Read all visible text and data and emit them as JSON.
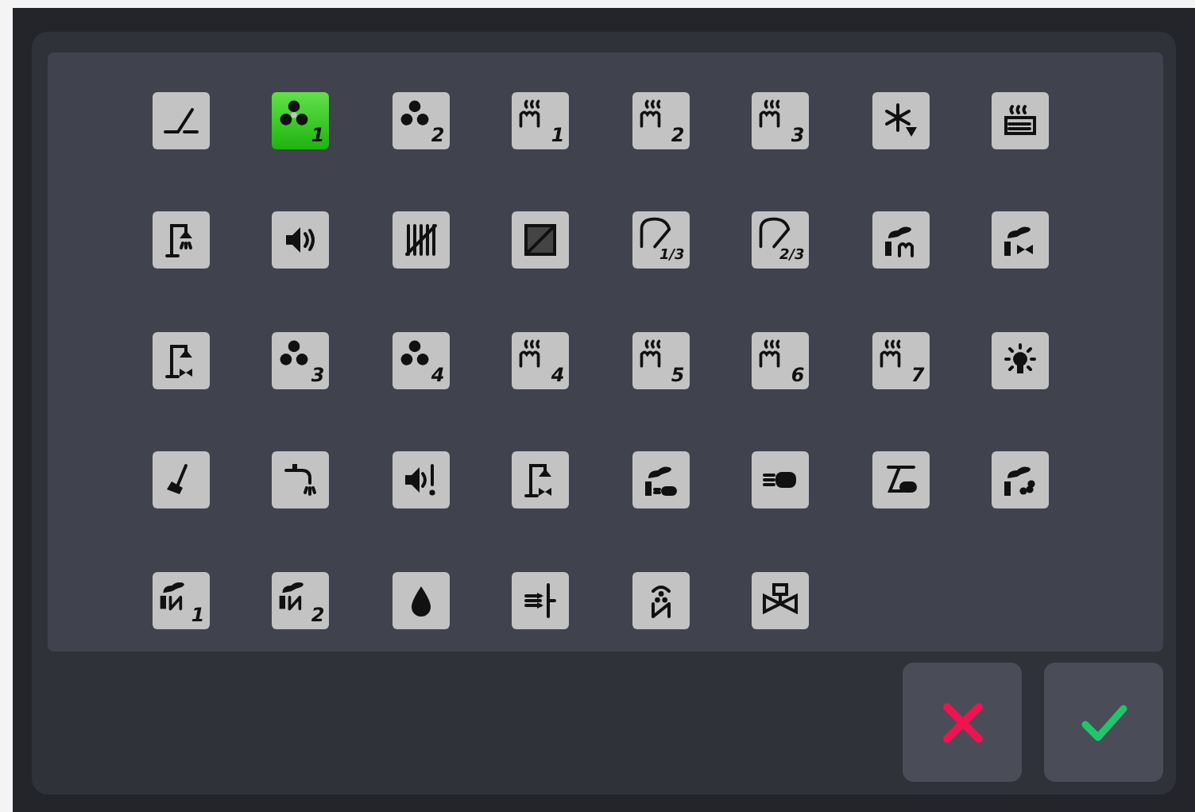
{
  "icons": [
    {
      "kind": "switch",
      "selected": false
    },
    {
      "kind": "fan",
      "sub": "1",
      "selected": true
    },
    {
      "kind": "fan",
      "sub": "2",
      "selected": false
    },
    {
      "kind": "heater",
      "sub": "1",
      "selected": false
    },
    {
      "kind": "heater",
      "sub": "2",
      "selected": false
    },
    {
      "kind": "heater",
      "sub": "3",
      "selected": false
    },
    {
      "kind": "defrost",
      "selected": false
    },
    {
      "kind": "floor-heat",
      "selected": false
    },
    {
      "kind": "shower",
      "selected": false
    },
    {
      "kind": "speaker",
      "selected": false
    },
    {
      "kind": "blind-open",
      "selected": false
    },
    {
      "kind": "blind-closed",
      "selected": false
    },
    {
      "kind": "door",
      "sub": "1/3",
      "selected": false
    },
    {
      "kind": "door",
      "sub": "2/3",
      "selected": false
    },
    {
      "kind": "chimney-heater",
      "selected": false
    },
    {
      "kind": "chimney-valve",
      "selected": false
    },
    {
      "kind": "shower-valve",
      "selected": false
    },
    {
      "kind": "fan",
      "sub": "3",
      "selected": false
    },
    {
      "kind": "fan",
      "sub": "4",
      "selected": false
    },
    {
      "kind": "heater",
      "sub": "4",
      "selected": false
    },
    {
      "kind": "heater",
      "sub": "5",
      "selected": false
    },
    {
      "kind": "heater",
      "sub": "6",
      "selected": false
    },
    {
      "kind": "heater",
      "sub": "7",
      "selected": false
    },
    {
      "kind": "light",
      "selected": false
    },
    {
      "kind": "broom",
      "selected": false
    },
    {
      "kind": "tap",
      "selected": false
    },
    {
      "kind": "alarm",
      "selected": false
    },
    {
      "kind": "shower-valve",
      "selected": false
    },
    {
      "kind": "chimney-burner",
      "selected": false
    },
    {
      "kind": "burner",
      "selected": false
    },
    {
      "kind": "burner-ignite",
      "selected": false
    },
    {
      "kind": "chimney-pellet",
      "selected": false
    },
    {
      "kind": "chimney-gate",
      "sub": "1",
      "selected": false
    },
    {
      "kind": "chimney-gate",
      "sub": "2",
      "selected": false
    },
    {
      "kind": "drop",
      "selected": false
    },
    {
      "kind": "inlet",
      "selected": false
    },
    {
      "kind": "fan-gate",
      "selected": false
    },
    {
      "kind": "valve",
      "selected": false
    }
  ],
  "buttons": [
    {
      "kind": "cancel"
    },
    {
      "kind": "confirm"
    }
  ]
}
